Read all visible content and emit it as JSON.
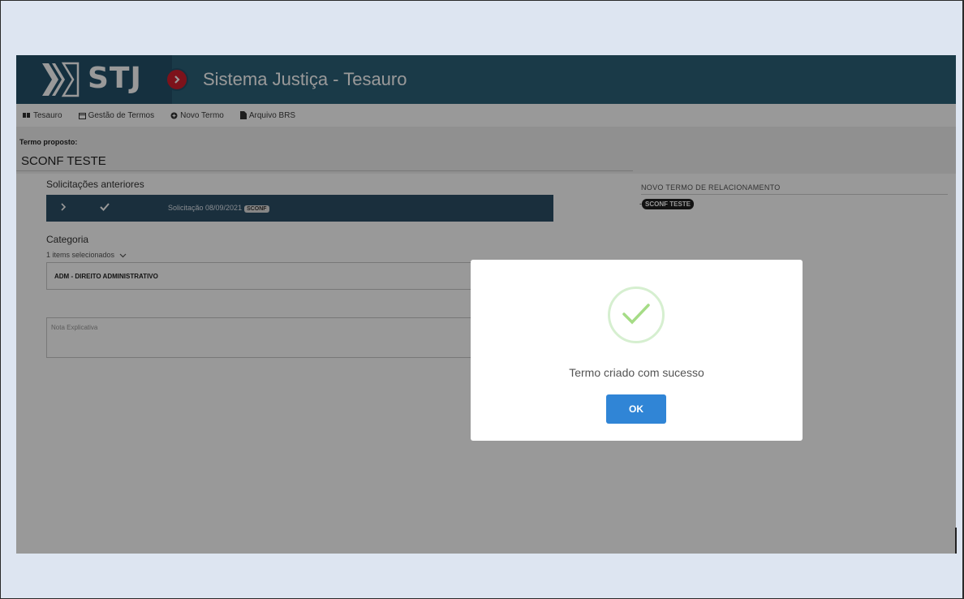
{
  "header": {
    "logo_text": "STJ",
    "app_title": "Sistema Justiça - Tesauro"
  },
  "menu": [
    {
      "icon": "book-icon",
      "label": "Tesauro"
    },
    {
      "icon": "calendar-icon",
      "label": "Gestão de Termos"
    },
    {
      "icon": "plus-circle-icon",
      "label": "Novo Termo"
    },
    {
      "icon": "file-icon",
      "label": "Arquivo BRS"
    }
  ],
  "term": {
    "label": "Termo proposto:",
    "value": "SCONF TESTE"
  },
  "requests": {
    "title": "Solicitações anteriores",
    "item_text": "Solicitação 08/09/2021",
    "item_tag": "SCONF"
  },
  "category": {
    "title": "Categoria",
    "selected_count": "1 items selecionados",
    "value": "ADM - DIREITO ADMINISTRATIVO"
  },
  "note": {
    "placeholder": "Nota Explicativa"
  },
  "relationship": {
    "title": "NOVO TERMO DE RELACIONAMENTO",
    "item_prefix": "-",
    "item_chip": "SCONF TESTE"
  },
  "modal": {
    "message": "Termo criado com sucesso",
    "ok_label": "OK"
  },
  "colors": {
    "header": "#2c6179",
    "request_bar": "#2c4f66",
    "ok_button": "#3085d6",
    "success": "#a5dc86"
  }
}
